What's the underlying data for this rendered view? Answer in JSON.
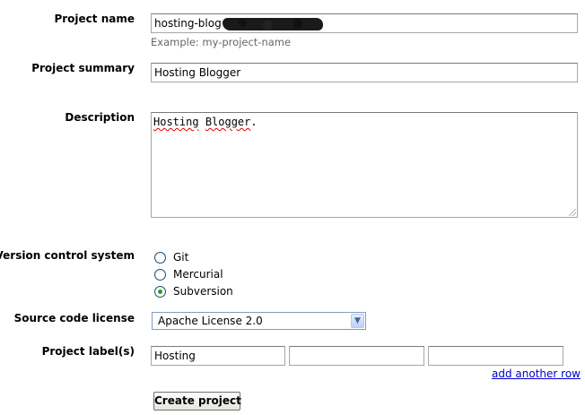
{
  "form": {
    "project_name": {
      "label": "Project name",
      "value": "hosting-blog",
      "hint": "Example: my-project-name"
    },
    "project_summary": {
      "label": "Project summary",
      "value": "Hosting Blogger"
    },
    "description": {
      "label": "Description",
      "word1": "Hosting",
      "word2": "Blogger",
      "suffix": "."
    },
    "vcs": {
      "label": "Version control system",
      "options": [
        "Git",
        "Mercurial",
        "Subversion"
      ],
      "selected": "Subversion"
    },
    "license": {
      "label": "Source code license",
      "selected": "Apache License 2.0"
    },
    "labels": {
      "label": "Project label(s)",
      "values": [
        "Hosting",
        "",
        ""
      ],
      "add_row_link": "add another row"
    },
    "submit_label": "Create project"
  },
  "icons": {
    "select_arrow": "chevron-down-icon",
    "resize_grip": "resize-grip-icon"
  },
  "colors": {
    "link": "#0000cc",
    "hint": "#666666",
    "radio_checked": "#21a121",
    "spellcheck_underline": "#e00000"
  }
}
